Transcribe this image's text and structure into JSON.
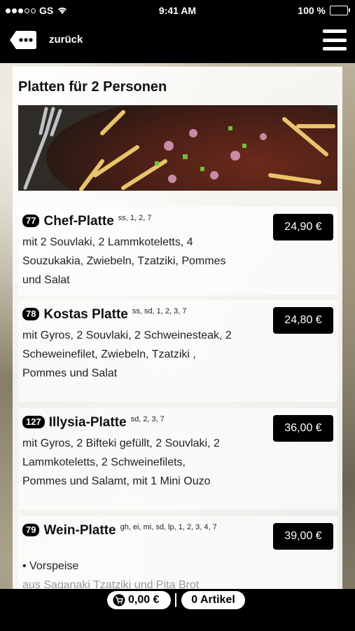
{
  "status_bar": {
    "carrier": "GS",
    "time": "9:41 AM",
    "battery": "100 %"
  },
  "nav": {
    "back_label": "zurück"
  },
  "section": {
    "title": "Platten für 2 Personen"
  },
  "items": [
    {
      "number": "77",
      "name": "Chef-Platte",
      "allergens": "ss, 1, 2, 7",
      "description": "mit 2 Souvlaki, 2 Lammkoteletts, 4 Souzukakia, Zwiebeln, Tzatziki, Pommes und Salat",
      "price": "24,90 €"
    },
    {
      "number": "78",
      "name": "Kostas Platte",
      "allergens": "ss, sd, 1, 2, 3, 7",
      "description": "mit Gyros, 2 Souvlaki, 2 Schweinesteak, 2 Scheweinefilet, Zwiebeln, Tzatziki , Pommes und Salat",
      "price": "24,80 €"
    },
    {
      "number": "127",
      "name": "Illysia-Platte",
      "allergens": "sd, 2, 3, 7",
      "description": "mit Gyros, 2 Bifteki gefüllt, 2 Souvlaki, 2 Lammkoteletts, 2 Schweinefilets, Pommes und Salamt, mit 1 Mini Ouzo",
      "price": "36,00 €"
    },
    {
      "number": "79",
      "name": "Wein-Platte",
      "allergens": "gh, ei, mi, sd, lp, 1, 2, 3, 4, 7",
      "description": "• Vorspeise",
      "description2": "aus Saganaki Tzatziki und Pita Brot",
      "price": "39,00 €"
    }
  ],
  "cart": {
    "total": "0,00 €",
    "articles": "0 Artikel"
  }
}
